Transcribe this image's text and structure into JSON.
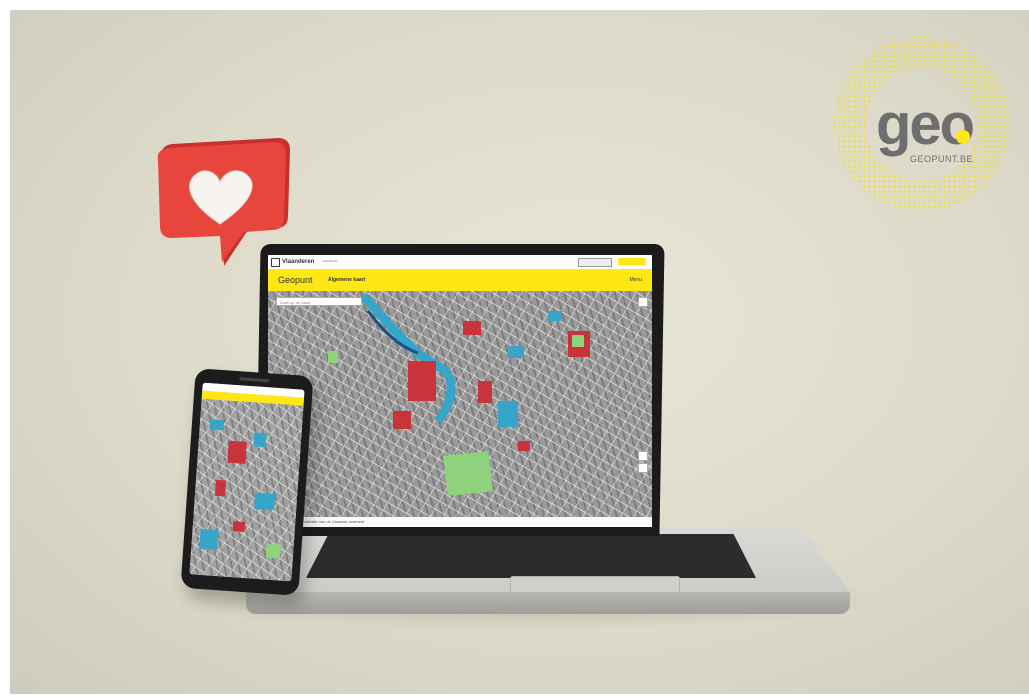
{
  "logo": {
    "wordmark": "geo",
    "caption": "GEOPUNT.BE"
  },
  "laptop_ui": {
    "topbar": {
      "brand": "Vlaanderen",
      "sub": "GEOPUNT"
    },
    "header": {
      "title": "Geopunt",
      "breadcrumb": "Algemene kaart",
      "menu": "Menu"
    },
    "search": {
      "placeholder": "Zoek op de kaart"
    },
    "footer": {
      "text": "Dit is de officiële website van de Vlaamse overheid"
    }
  },
  "colors": {
    "accent_yellow": "#ffe615",
    "badge_red": "#e8453c",
    "map_red": "#c9343a",
    "map_blue": "#35a6c8",
    "map_green": "#8fd27c"
  },
  "icons": [
    "heart-icon",
    "vlaanderen-logo-icon",
    "search-icon",
    "zoom-in-icon",
    "zoom-out-icon",
    "edit-icon"
  ]
}
